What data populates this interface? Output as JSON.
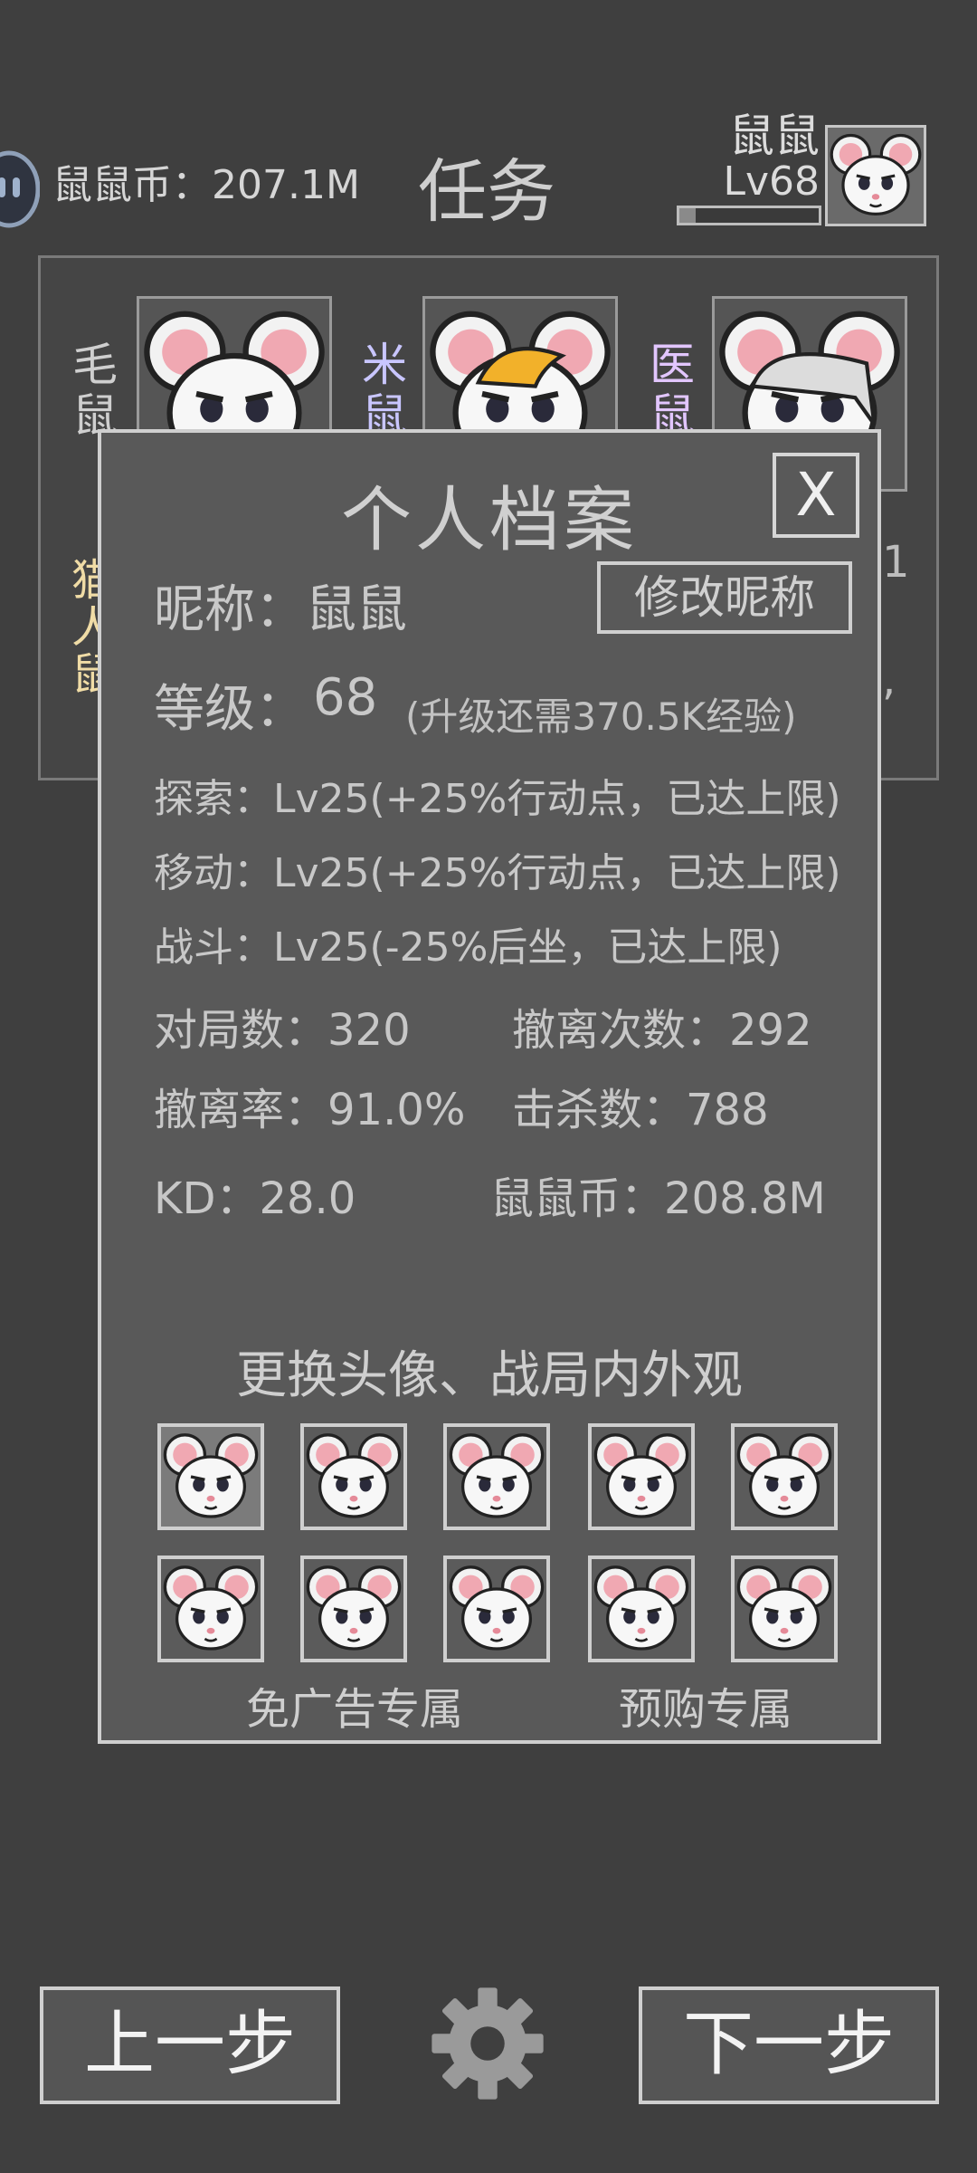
{
  "header": {
    "coin_label": "鼠鼠币：207.1M",
    "title": "任务",
    "player_name": "鼠鼠",
    "player_level": "Lv68",
    "xp_progress": 0.12,
    "coin_icon": "coin-face-icon",
    "avatar_icon": "white-mouse-avatar"
  },
  "squad": {
    "members": [
      {
        "label": "毛鼠",
        "portrait": "white-mouse-portrait",
        "label_color": "#cfcfcf"
      },
      {
        "label": "米鼠",
        "portrait": "yellow-hair-mouse-portrait",
        "label_color": "#c9c6ff"
      },
      {
        "label": "医鼠",
        "portrait": "grey-hair-mouse-portrait",
        "label_color": "#e2c6ff"
      }
    ],
    "behind_left_text": "猫人鼠",
    "behind_right_text_1": "1",
    "behind_right_text_2": ","
  },
  "profile": {
    "title": "个人档案",
    "close_label": "X",
    "nickname": "昵称：鼠鼠",
    "rename_label": "修改昵称",
    "level_label": "等级：",
    "level_value": "68",
    "level_note": "(升级还需370.5K经验)",
    "explore": "探索：Lv25(+25%行动点，已达上限)",
    "move": "移动：Lv25(+25%行动点，已达上限)",
    "combat": "战斗：Lv25(-25%后坐，已达上限)",
    "matches": "对局数：320",
    "extractions": "撤离次数：292",
    "extract_rate": "撤离率：91.0%",
    "kills": "击杀数：788",
    "kd": "KD：28.0",
    "coins": "鼠鼠币：208.8M",
    "appearance_title": "更换头像、战局内外观",
    "no_ads_caption": "免广告专属",
    "preorder_caption": "预购专属",
    "skins": [
      {
        "name": "white-mouse-skin-1",
        "selected": true
      },
      {
        "name": "white-mouse-skin-2",
        "selected": false
      },
      {
        "name": "white-mouse-skin-3",
        "selected": false
      },
      {
        "name": "white-mouse-skin-4",
        "selected": false
      },
      {
        "name": "white-mouse-skin-5",
        "selected": false
      },
      {
        "name": "white-mouse-skin-6",
        "selected": false
      },
      {
        "name": "white-mouse-skin-7",
        "selected": false
      },
      {
        "name": "white-mouse-skin-8",
        "selected": false
      },
      {
        "name": "white-mouse-skin-9",
        "selected": false
      },
      {
        "name": "white-mouse-skin-10",
        "selected": false
      }
    ]
  },
  "footer": {
    "prev_label": "上一步",
    "next_label": "下一步",
    "settings_icon": "gear-icon"
  }
}
